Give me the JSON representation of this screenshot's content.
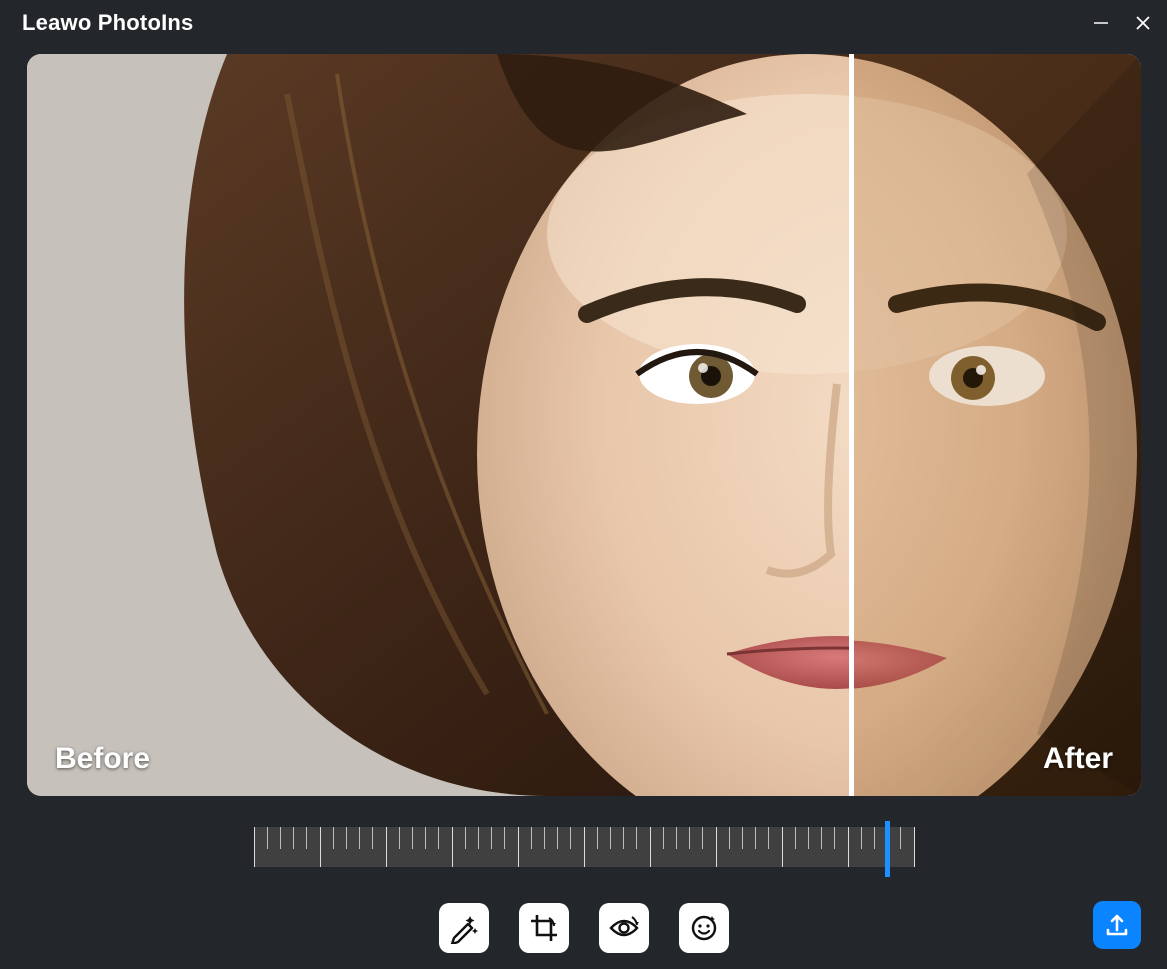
{
  "app": {
    "title": "Leawo PhotoIns"
  },
  "preview": {
    "before_label": "Before",
    "after_label": "After",
    "divider_position_percent": 74
  },
  "ruler": {
    "marker_position_percent": 96
  },
  "tools": {
    "magic": "auto-enhance-icon",
    "crop": "crop-rotate-icon",
    "eye": "eye-enhance-icon",
    "face": "face-retouch-icon"
  },
  "export": {
    "icon": "export-icon"
  },
  "colors": {
    "accent": "#0a84ff"
  }
}
